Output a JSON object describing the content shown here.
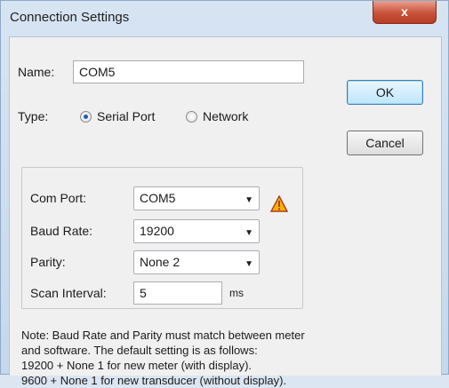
{
  "window": {
    "title": "Connection Settings",
    "close_label": "x"
  },
  "name_field": {
    "label": "Name:",
    "value": "COM5"
  },
  "type": {
    "label": "Type:",
    "options": [
      {
        "label": "Serial Port",
        "checked": true
      },
      {
        "label": "Network",
        "checked": false
      }
    ]
  },
  "buttons": {
    "ok": "OK",
    "cancel": "Cancel"
  },
  "serial": {
    "com_port": {
      "label": "Com Port:",
      "value": "COM5"
    },
    "baud_rate": {
      "label": "Baud Rate:",
      "value": "19200"
    },
    "parity": {
      "label": "Parity:",
      "value": "None 2"
    },
    "scan_interval": {
      "label": "Scan Interval:",
      "value": "5",
      "unit": "ms"
    }
  },
  "note": {
    "lines": [
      "Note:  Baud Rate and Parity must match between meter",
      " and software. The default setting is as follows:",
      " 19200 + None 1 for new meter (with display).",
      " 9600 + None 1 for new transducer (without display)."
    ]
  },
  "colors": {
    "accent": "#3c7fb1",
    "close": "#c8513a",
    "warning": "#f2b400"
  },
  "icons": {
    "warning": "warning-icon"
  }
}
